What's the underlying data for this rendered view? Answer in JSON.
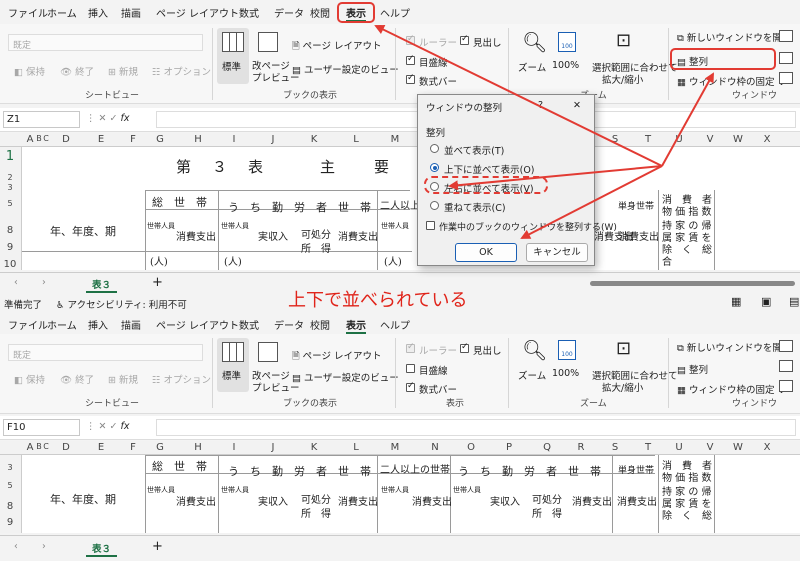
{
  "menu": [
    "ファイル",
    "ホーム",
    "挿入",
    "描画",
    "ページ レイアウト",
    "数式",
    "データ",
    "校閲",
    "表示",
    "ヘルプ"
  ],
  "ribbon": {
    "sheet_view": {
      "default_value": "既定",
      "keep": "保持",
      "exit": "終了",
      "new": "新規",
      "options": "オプション",
      "group": "シートビュー"
    },
    "workbook_views": {
      "normal": "標準",
      "page_break_1": "改ページ",
      "page_break_2": "プレビュー",
      "page_layout": "ページ レイアウト",
      "custom_views": "ユーザー設定のビュー",
      "group": "ブックの表示"
    },
    "show": {
      "ruler": "ルーラー",
      "gridlines": "目盛線",
      "formula_bar": "数式バー",
      "headings": "見出し",
      "group": "表示"
    },
    "zoom": {
      "zoom": "ズーム",
      "hundred": "100%",
      "zoom_sel_1": "選択範囲に合わせて",
      "zoom_sel_2": "拡大/縮小",
      "group": "ズーム",
      "icon_label": "100"
    },
    "window": {
      "new_window": "新しいウィンドウを開く",
      "arrange": "整列",
      "freeze": "ウィンドウ枠の固定",
      "group": "ウィンドウ"
    }
  },
  "top_pane": {
    "name_box": "Z1",
    "sheet_tab": "表３",
    "status_ready": "準備完了",
    "accessibility": "アクセシビリティ: 利用不可"
  },
  "bottom_pane": {
    "name_box": "F10",
    "sheet_tab": "表３"
  },
  "fx": "fx",
  "columns": [
    "A",
    "B",
    "C",
    "D",
    "E",
    "F",
    "G",
    "H",
    "I",
    "J",
    "K",
    "L",
    "M",
    "N",
    "O",
    "P",
    "Q",
    "R",
    "S",
    "T",
    "U",
    "V",
    "W",
    "X"
  ],
  "rows_top": [
    "1",
    "2",
    "3",
    "5",
    "8",
    "9",
    "10"
  ],
  "rows_bottom": [
    "3",
    "5",
    "8",
    "9"
  ],
  "sheet": {
    "title": "第　３　表　　　主　　要　　家",
    "h_total": "総　世　帯",
    "h_workers": "う　ち　勤　労　者　世　帯",
    "h_two_plus": "二人以上の世帯",
    "h_single": "単身世帯",
    "year_period": "年、年度、期",
    "hh_members": "世帯人員",
    "consumption": "消費支出",
    "income": "実収入",
    "disposable_1": "可処分",
    "disposable_2": "所　得",
    "unit_person": "(人)",
    "cpi_1": "消　費　者",
    "cpi_2": "物 価 指 数",
    "cpi_3": "持 家 の 帰",
    "cpi_4": "属 家 賃 を",
    "cpi_5": "除　く　総",
    "cpi_6": "合"
  },
  "dialog": {
    "title": "ウィンドウの整列",
    "question": "?",
    "close": "✕",
    "group": "整列",
    "opt_tiled": "並べて表示(T)",
    "opt_horizontal": "上下に並べて表示(O)",
    "opt_vertical": "左右に並べて表示(V)",
    "opt_cascade": "重ねて表示(C)",
    "active_only": "作業中のブックのウィンドウを整列する(W)",
    "ok": "OK",
    "cancel": "キャンセル"
  },
  "caption": "上下で並べられている",
  "colors": {
    "red": "#e23b33",
    "accent": "#1a5fb4",
    "sheet_tab_underline": "#1e7145"
  }
}
